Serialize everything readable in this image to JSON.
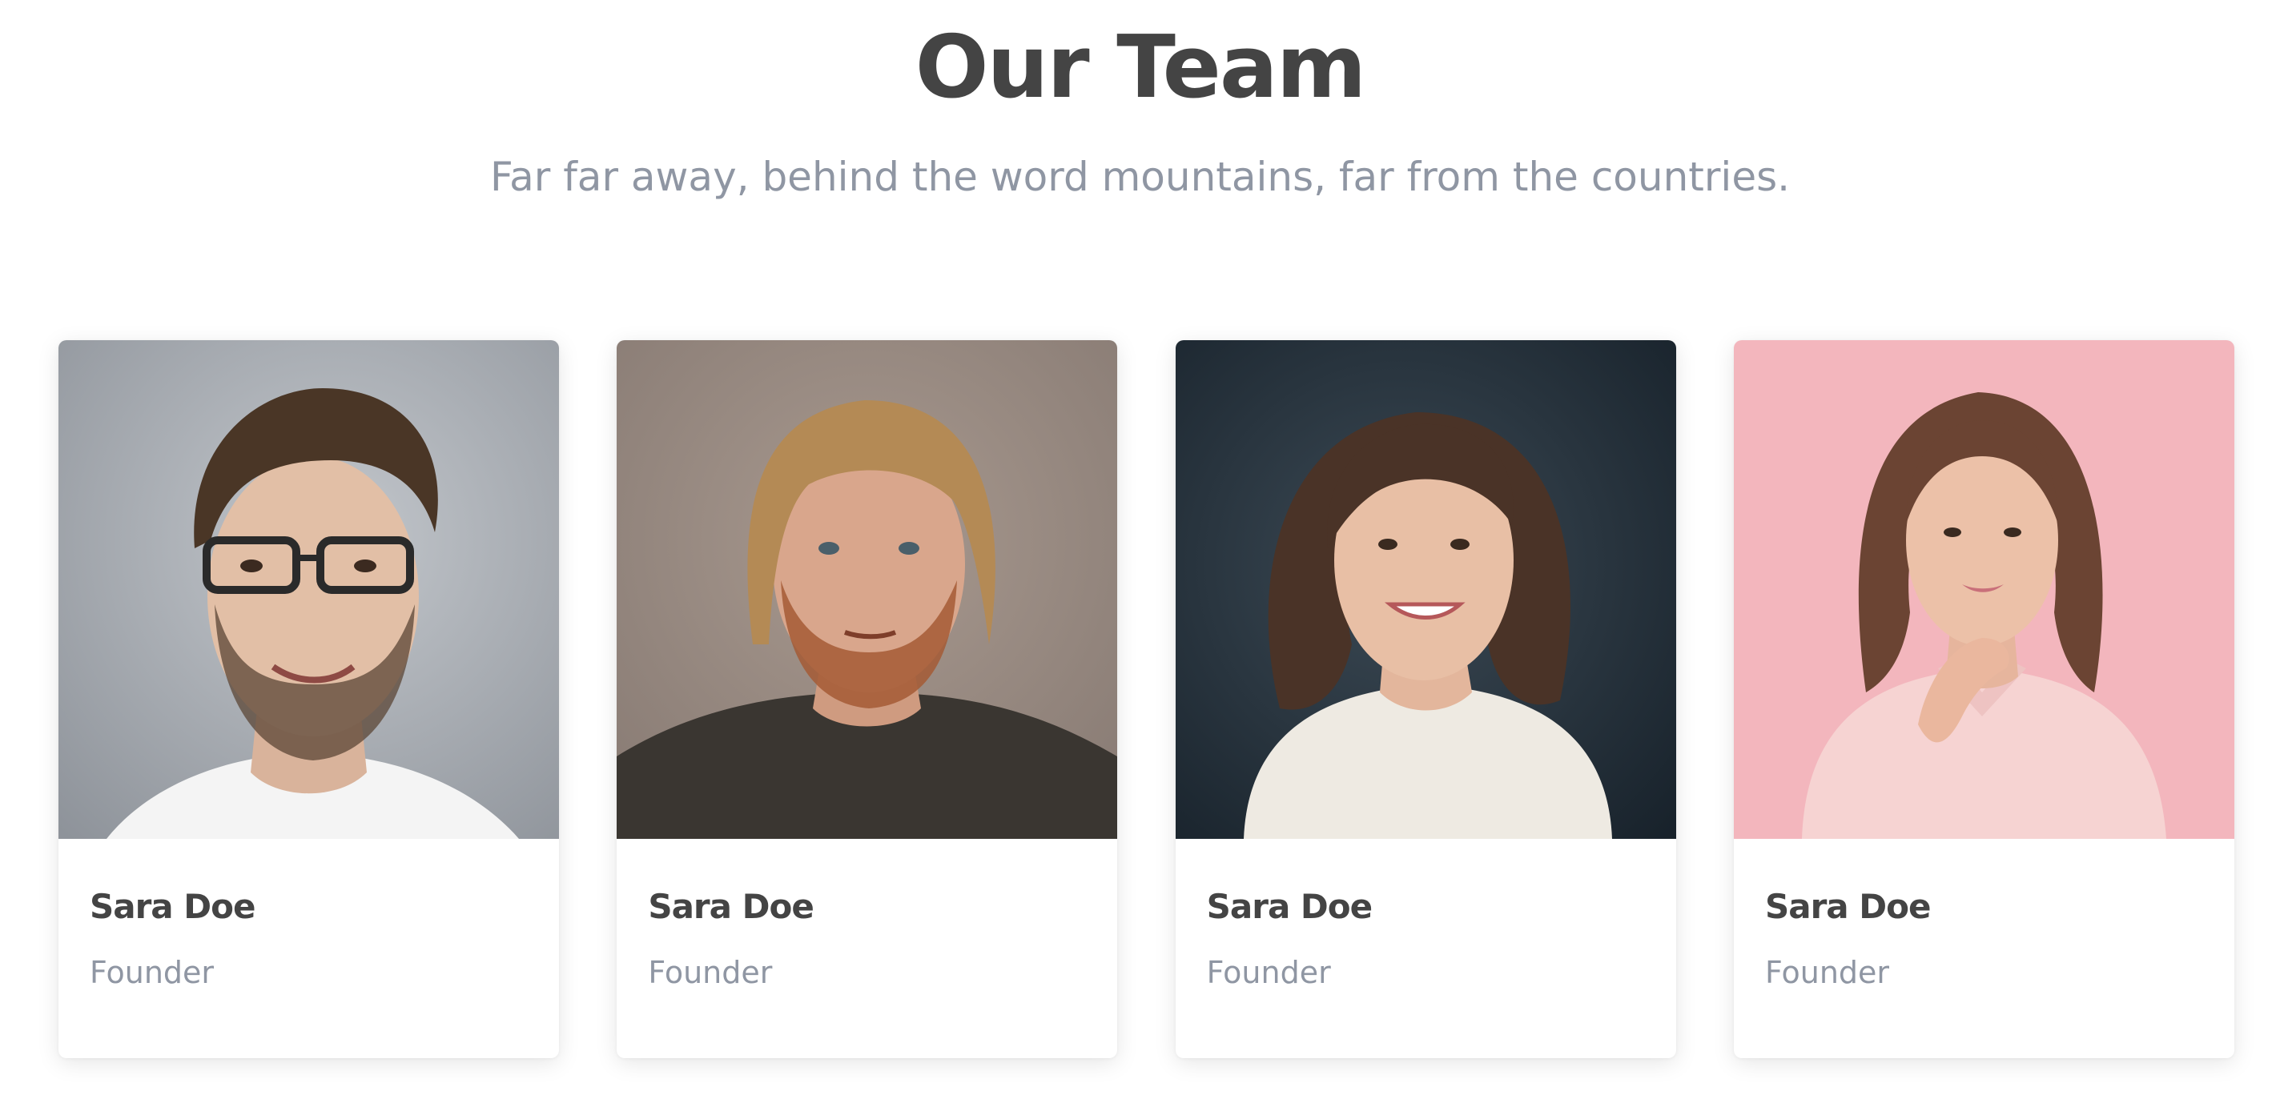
{
  "section": {
    "title": "Our Team",
    "subtitle": "Far far away, behind the word mountains, far from the countries."
  },
  "team": [
    {
      "name": "Sara Doe",
      "role": "Founder",
      "photo_bg": "#a8adb3"
    },
    {
      "name": "Sara Doe",
      "role": "Founder",
      "photo_bg": "#9a8e86"
    },
    {
      "name": "Sara Doe",
      "role": "Founder",
      "photo_bg": "#2c3a44"
    },
    {
      "name": "Sara Doe",
      "role": "Founder",
      "photo_bg": "#f3b6bd"
    }
  ],
  "colors": {
    "heading": "#444444",
    "muted": "#8f96a3",
    "card_bg": "#ffffff"
  }
}
